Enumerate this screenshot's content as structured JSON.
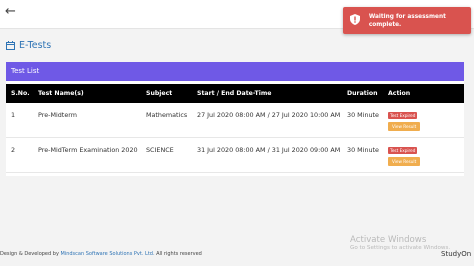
{
  "topbar": {
    "back_icon": "arrow-left-icon"
  },
  "toast": {
    "icon": "shield-alert-icon",
    "message": "Waiting for assessment complete.",
    "color": "#d9534f"
  },
  "page": {
    "title": "E-Tests",
    "title_icon": "calendar-icon"
  },
  "panel": {
    "header": "Test List",
    "header_color": "#6f59e6",
    "columns": [
      "S.No.",
      "Test Name(s)",
      "Subject",
      "Start / End Date-Time",
      "Duration",
      "Action"
    ],
    "rows": [
      {
        "sno": "1",
        "name": "Pre-Midterm",
        "subject": "Mathematics",
        "datetime": "27 Jul 2020 08:00 AM / 27 Jul 2020 10:00 AM",
        "duration": "30 Minute",
        "status": "Test Expired",
        "action": "View Result"
      },
      {
        "sno": "2",
        "name": "Pre-MidTerm Examination 2020",
        "subject": "SCIENCE",
        "datetime": "31 Jul 2020 08:00 AM / 31 Jul 2020 09:00 AM",
        "duration": "30 Minute",
        "status": "Test Expired",
        "action": "View Result"
      }
    ]
  },
  "footer": {
    "prefix": "Design & Developed by",
    "company": "Mindscan Software Solutions Pvt. Ltd.",
    "suffix": "All rights reserved"
  },
  "watermark": {
    "line1": "Activate Windows",
    "line2": "Go to Settings to activate Windows."
  },
  "brand": "StudyOn"
}
